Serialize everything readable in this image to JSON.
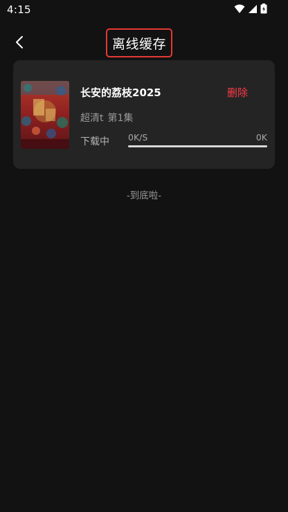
{
  "status_bar": {
    "time": "4:15",
    "icons": [
      "wifi-icon",
      "cellular-signal-icon",
      "battery-icon"
    ]
  },
  "header": {
    "back_icon": "chevron-left-icon",
    "title": "离线缓存",
    "title_highlight_color": "#e53935"
  },
  "downloads": [
    {
      "title": "长安的荔枝2025",
      "delete_label": "删除",
      "quality": "超清t",
      "episode": "第1集",
      "status": "下载中",
      "speed": "0K/S",
      "size": "0K",
      "progress": 0
    }
  ],
  "footer": {
    "end_text": "-到底啦-"
  },
  "colors": {
    "background": "#121212",
    "card": "#242424",
    "accent": "#ff3b47"
  }
}
